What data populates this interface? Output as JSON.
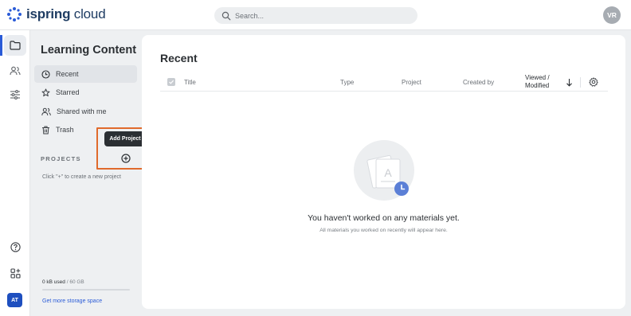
{
  "app": {
    "logo_bold": "ispring",
    "logo_rest": " cloud",
    "user_initials": "VR"
  },
  "search": {
    "placeholder": "Search..."
  },
  "rail": {
    "items": [
      {
        "icon": "folder-icon",
        "active": true
      },
      {
        "icon": "users-icon",
        "active": false
      },
      {
        "icon": "sliders-icon",
        "active": false
      },
      {
        "icon": "help-icon",
        "active": false
      },
      {
        "icon": "apps-icon",
        "active": false
      }
    ],
    "account_initials": "AT"
  },
  "sidebar": {
    "title": "Learning Content",
    "items": [
      {
        "label": "Recent",
        "icon": "clock-icon",
        "active": true
      },
      {
        "label": "Starred",
        "icon": "star-icon",
        "active": false
      },
      {
        "label": "Shared with me",
        "icon": "users-icon",
        "active": false
      },
      {
        "label": "Trash",
        "icon": "trash-icon",
        "active": false
      }
    ],
    "projects_label": "PROJECTS",
    "projects_hint": "Click \"+\" to create a new project",
    "tooltip": "Add Project",
    "storage_used": "0 kB used",
    "storage_total": " / 60 GB",
    "storage_fraction": 0,
    "storage_link": "Get more storage space"
  },
  "main": {
    "title": "Recent",
    "columns": {
      "title": "Title",
      "type": "Type",
      "project": "Project",
      "created_by": "Created by",
      "viewed_line1": "Viewed /",
      "viewed_line2": "Modified"
    },
    "empty_title": "You haven't worked on any materials yet.",
    "empty_subtitle": "All materials you worked on recently will appear here."
  },
  "colors": {
    "accent": "#2a5bd7",
    "highlight": "#e06a2c",
    "background": "#eef0f2"
  }
}
